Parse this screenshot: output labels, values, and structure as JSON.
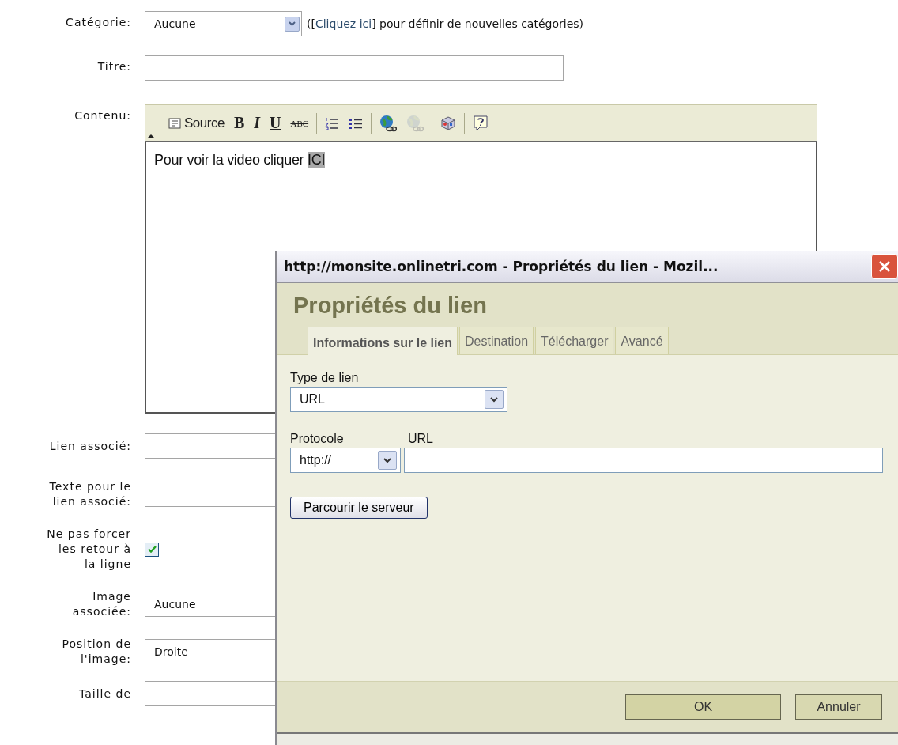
{
  "form": {
    "category": {
      "label": "Catégorie:",
      "value": "Aucune",
      "note_before": "([",
      "link": "Cliquez ici",
      "note_after": "] pour définir de nouvelles catégories)"
    },
    "title": {
      "label": "Titre:"
    },
    "content": {
      "label": "Contenu:",
      "toolbar": [
        {
          "kind": "source",
          "text": "Source",
          "disabled": false
        },
        {
          "kind": "bold",
          "text": "B",
          "disabled": false
        },
        {
          "kind": "italic",
          "text": "I",
          "disabled": false
        },
        {
          "kind": "underline",
          "text": "U",
          "disabled": false
        },
        {
          "kind": "strike",
          "text": "ABC",
          "disabled": false
        },
        {
          "kind": "separator"
        },
        {
          "kind": "numbered-list",
          "disabled": false
        },
        {
          "kind": "bulleted-list",
          "disabled": false
        },
        {
          "kind": "separator"
        },
        {
          "kind": "link",
          "disabled": false
        },
        {
          "kind": "unlink",
          "disabled": true
        },
        {
          "kind": "separator"
        },
        {
          "kind": "object",
          "disabled": false
        },
        {
          "kind": "separator"
        },
        {
          "kind": "help",
          "disabled": false
        }
      ],
      "text": "Pour voir la video cliquer ",
      "selected_text": "ICI"
    },
    "link": {
      "label": "Lien associé:"
    },
    "link_text": {
      "label": "Texte pour le\nlien associé:"
    },
    "no_breaks": {
      "label": "Ne pas forcer\nles retour à\nla ligne",
      "checked": true
    },
    "image": {
      "label": "Image\nassociée:",
      "value": "Aucune"
    },
    "image_position": {
      "label": "Position de\nl'image:",
      "value": "Droite"
    },
    "size": {
      "label": "Taille de"
    }
  },
  "dialog": {
    "title": "http://monsite.onlinetri.com - Propriétés du lien - Mozil...",
    "heading": "Propriétés du lien",
    "tabs": [
      {
        "label": "Informations sur le lien",
        "selected": true
      },
      {
        "label": "Destination",
        "selected": false
      },
      {
        "label": "Télécharger",
        "selected": false
      },
      {
        "label": "Avancé",
        "selected": false
      }
    ],
    "link_type": {
      "label": "Type de lien",
      "value": "URL"
    },
    "protocol": {
      "label": "Protocole",
      "value": "http://"
    },
    "url": {
      "label": "URL"
    },
    "browse_button": "Parcourir le serveur",
    "ok_button": "OK",
    "cancel_button": "Annuler"
  }
}
